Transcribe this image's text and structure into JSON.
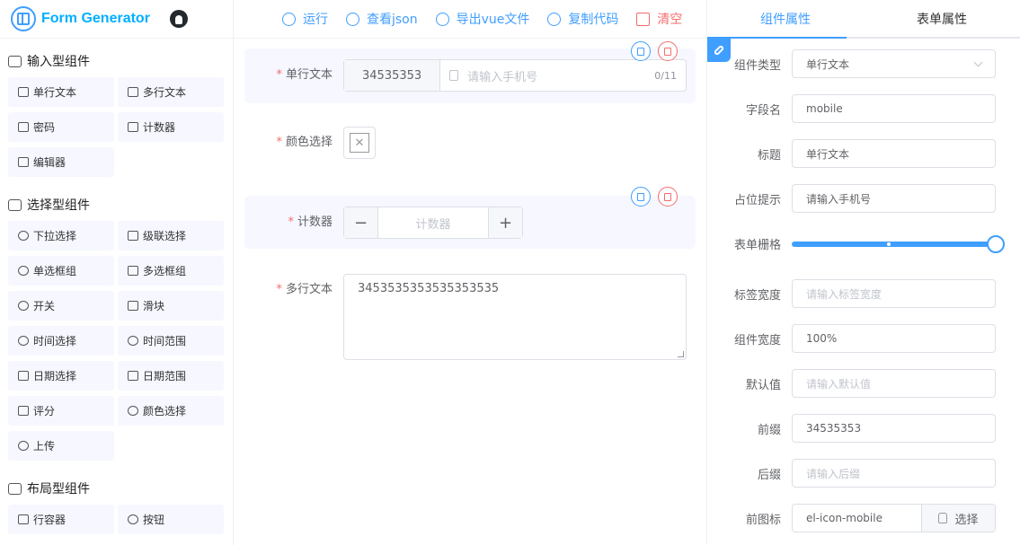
{
  "app": {
    "title": "Form Generator"
  },
  "toolbar": {
    "run": "运行",
    "view_json": "查看json",
    "export_vue": "导出vue文件",
    "copy_code": "复制代码",
    "clear": "清空"
  },
  "left_panel": {
    "groups": [
      {
        "title": "输入型组件",
        "items": [
          "单行文本",
          "多行文本",
          "密码",
          "计数器",
          "编辑器"
        ]
      },
      {
        "title": "选择型组件",
        "items": [
          "下拉选择",
          "级联选择",
          "单选框组",
          "多选框组",
          "开关",
          "滑块",
          "时间选择",
          "时间范围",
          "日期选择",
          "日期范围",
          "评分",
          "颜色选择",
          "上传"
        ]
      },
      {
        "title": "布局型组件",
        "items": [
          "行容器",
          "按钮"
        ]
      }
    ]
  },
  "canvas": {
    "fields": [
      {
        "label": "单行文本",
        "required": true,
        "prepend": "34535353",
        "placeholder": "请输入手机号",
        "counter": "0/11"
      },
      {
        "label": "颜色选择",
        "required": true
      },
      {
        "label": "计数器",
        "required": true,
        "placeholder": "计数器"
      },
      {
        "label": "多行文本",
        "required": true,
        "value": "3453535353535353535"
      }
    ]
  },
  "right_panel": {
    "tabs": [
      "组件属性",
      "表单属性"
    ],
    "active_tab": 0,
    "props": {
      "component_type": {
        "label": "组件类型",
        "value": "单行文本"
      },
      "field_name": {
        "label": "字段名",
        "value": "mobile"
      },
      "title": {
        "label": "标题",
        "value": "单行文本"
      },
      "placeholder": {
        "label": "占位提示",
        "value": "请输入手机号"
      },
      "grid": {
        "label": "表单栅格",
        "value_fraction": 1.0
      },
      "label_width": {
        "label": "标签宽度",
        "placeholder": "请输入标签宽度"
      },
      "comp_width": {
        "label": "组件宽度",
        "value": "100%"
      },
      "default_value": {
        "label": "默认值",
        "placeholder": "请输入默认值"
      },
      "prefix": {
        "label": "前缀",
        "value": "34535353"
      },
      "suffix": {
        "label": "后缀",
        "placeholder": "请输入后缀"
      },
      "prefix_icon": {
        "label": "前图标",
        "value": "el-icon-mobile",
        "button": "选择"
      }
    }
  },
  "colors": {
    "accent": "#409eff",
    "danger": "#f56c6c",
    "logo": "#00afff"
  }
}
